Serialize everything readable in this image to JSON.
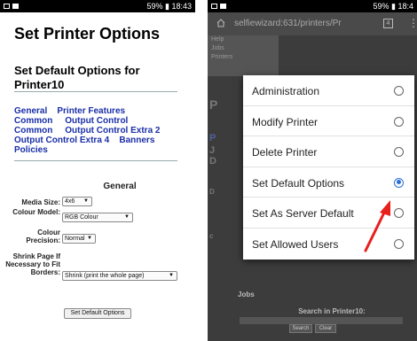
{
  "left_screen": {
    "status_bar": {
      "right_text": "59% ▮ 18:43"
    },
    "title": "Set Printer Options",
    "subtitle": "Set Default Options for Printer10",
    "links": [
      "General",
      "Printer Features",
      "Common",
      "Output Control",
      "Common",
      "Output Control Extra 2",
      "Output Control Extra 4",
      "Banners",
      "Policies"
    ],
    "section_heading": "General",
    "form": {
      "media_size": {
        "label": "Media Size:",
        "value": "4x6"
      },
      "colour_model": {
        "label": "Colour Model:",
        "value": "RGB Colour"
      },
      "colour_precision": {
        "label": "Colour Precision:",
        "value": "Normal"
      },
      "shrink": {
        "label": "Shrink Page If Necessary to Fit Borders:",
        "value": "Shrink (print the whole page)"
      }
    },
    "submit_button": "Set Default Options"
  },
  "right_screen": {
    "status_bar": {
      "right_text": "59% ▮ 18:4"
    },
    "url": "selfiewizard:631/printers/Pr",
    "tab_count": "4",
    "bg_nav_items": [
      "Help",
      "Jobs",
      "Printers"
    ],
    "menu": {
      "items": [
        {
          "label": "Administration",
          "selected": false
        },
        {
          "label": "Modify Printer",
          "selected": false
        },
        {
          "label": "Delete Printer",
          "selected": false
        },
        {
          "label": "Set Default Options",
          "selected": true
        },
        {
          "label": "Set As Server Default",
          "selected": false
        },
        {
          "label": "Set Allowed Users",
          "selected": false
        }
      ]
    },
    "bg_jobs_heading": "Jobs",
    "bg_search_label": "Search in Printer10:",
    "bg_buttons": [
      "Search",
      "Clear"
    ]
  },
  "colors": {
    "link_blue": "#1a2fa8",
    "radio_selected": "#2b6fd8",
    "annotation_arrow": "#e8201c"
  }
}
